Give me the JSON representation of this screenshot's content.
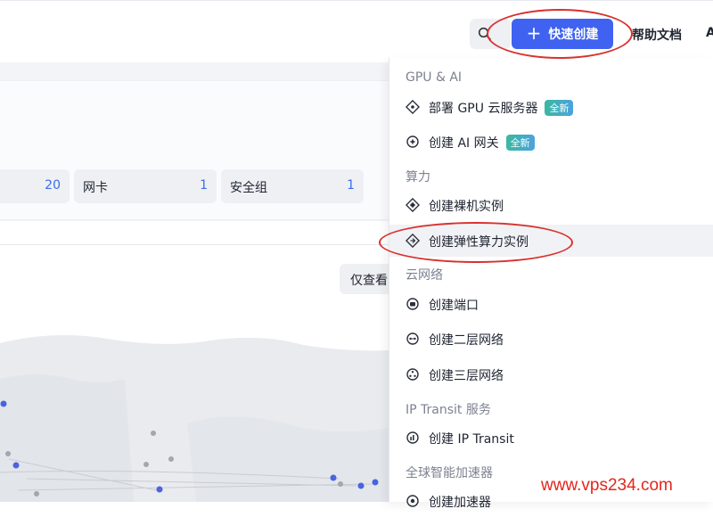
{
  "header": {
    "quick_create_label": "快速创建",
    "help_label": "帮助文档",
    "user_initial": "A",
    "search_icon": "search-icon",
    "plus_glyph": "+"
  },
  "stats": [
    {
      "label": "",
      "value": "20"
    },
    {
      "label": "网卡",
      "value": "1"
    },
    {
      "label": "安全组",
      "value": "1"
    }
  ],
  "view_only_label": "仅查看",
  "menu": {
    "groups": [
      {
        "title": "GPU & AI",
        "items": [
          {
            "label": "部署 GPU 云服务器",
            "badge": "全新",
            "icon": "gpu-diamond-icon"
          },
          {
            "label": "创建 AI 网关",
            "badge": "全新",
            "icon": "ai-gateway-icon"
          }
        ]
      },
      {
        "title": "算力",
        "items": [
          {
            "label": "创建裸机实例",
            "icon": "bare-metal-icon"
          },
          {
            "label": "创建弹性算力实例",
            "icon": "elastic-compute-icon"
          }
        ]
      },
      {
        "title": "云网络",
        "items": [
          {
            "label": "创建端口",
            "icon": "port-icon"
          },
          {
            "label": "创建二层网络",
            "icon": "l2-network-icon"
          },
          {
            "label": "创建三层网络",
            "icon": "l3-network-icon"
          }
        ]
      },
      {
        "title": "IP Transit 服务",
        "items": [
          {
            "label": "创建 IP Transit",
            "icon": "ip-transit-icon"
          }
        ]
      },
      {
        "title": "全球智能加速器",
        "items": [
          {
            "label": "创建加速器",
            "icon": "accelerator-icon"
          }
        ]
      }
    ]
  },
  "watermark": "www.vps234.com",
  "colors": {
    "accent": "#3f63f0",
    "annotation": "#d8312f",
    "badge_start": "#3bb8a0",
    "badge_end": "#4aa3df",
    "watermark": "#e2261d"
  }
}
